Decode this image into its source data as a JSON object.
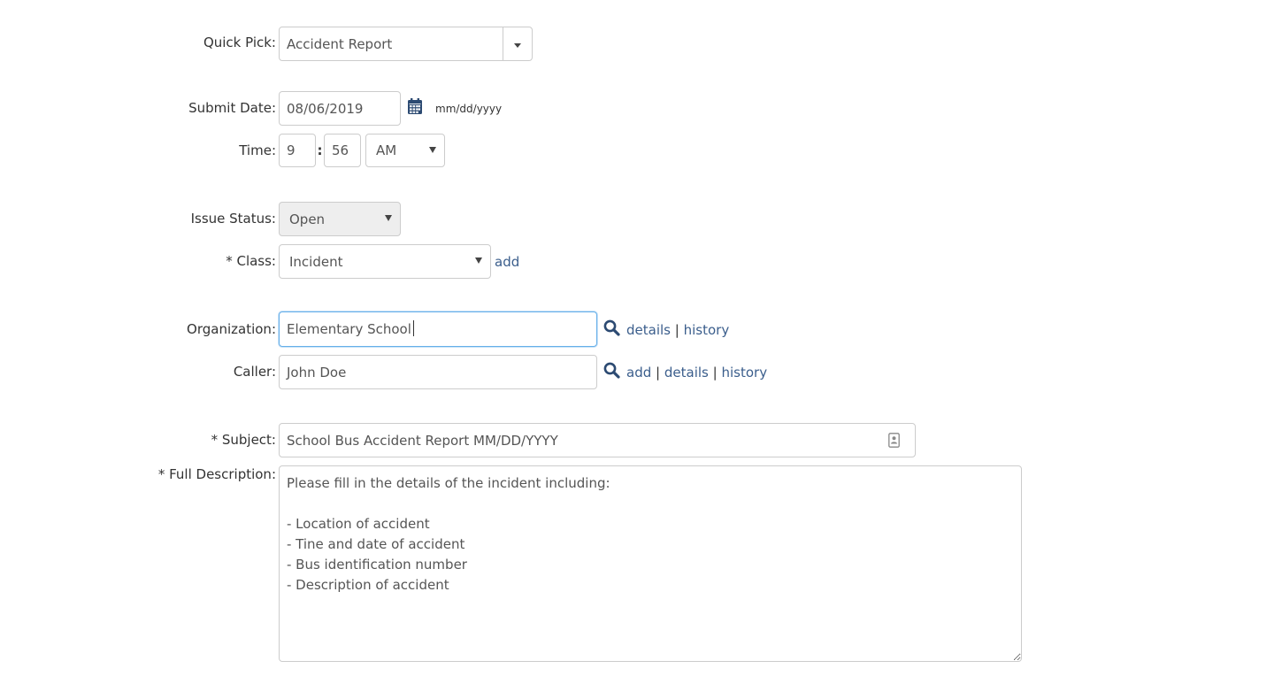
{
  "quick_pick": {
    "label": "Quick Pick:",
    "value": "Accident Report"
  },
  "submit_date": {
    "label": "Submit Date:",
    "value": "08/06/2019",
    "format_hint": "mm/dd/yyyy"
  },
  "time": {
    "label": "Time:",
    "hour": "9",
    "separator": ":",
    "minute": "56",
    "ampm": "AM"
  },
  "issue_status": {
    "label": "Issue Status:",
    "value": "Open"
  },
  "class": {
    "label": "* Class:",
    "value": "Incident",
    "add_link": "add"
  },
  "organization": {
    "label": "Organization:",
    "value": "Elementary School",
    "details_link": "details",
    "pipe": "|",
    "history_link": "history"
  },
  "caller": {
    "label": "Caller:",
    "value": "John Doe",
    "add_link": "add",
    "pipe": "|",
    "details_link": "details",
    "history_link": "history"
  },
  "subject": {
    "label": "* Subject:",
    "value": "School Bus Accident Report MM/DD/YYYY"
  },
  "full_description": {
    "label": "* Full Description:",
    "value": "Please fill in the details of the incident including:\n\n- Location of accident\n- Tine and date of accident\n- Bus identification number\n- Description of accident"
  },
  "colors": {
    "link": "#3b5e8c",
    "focus_border": "#66afe9",
    "icon": "#2c4a72"
  }
}
